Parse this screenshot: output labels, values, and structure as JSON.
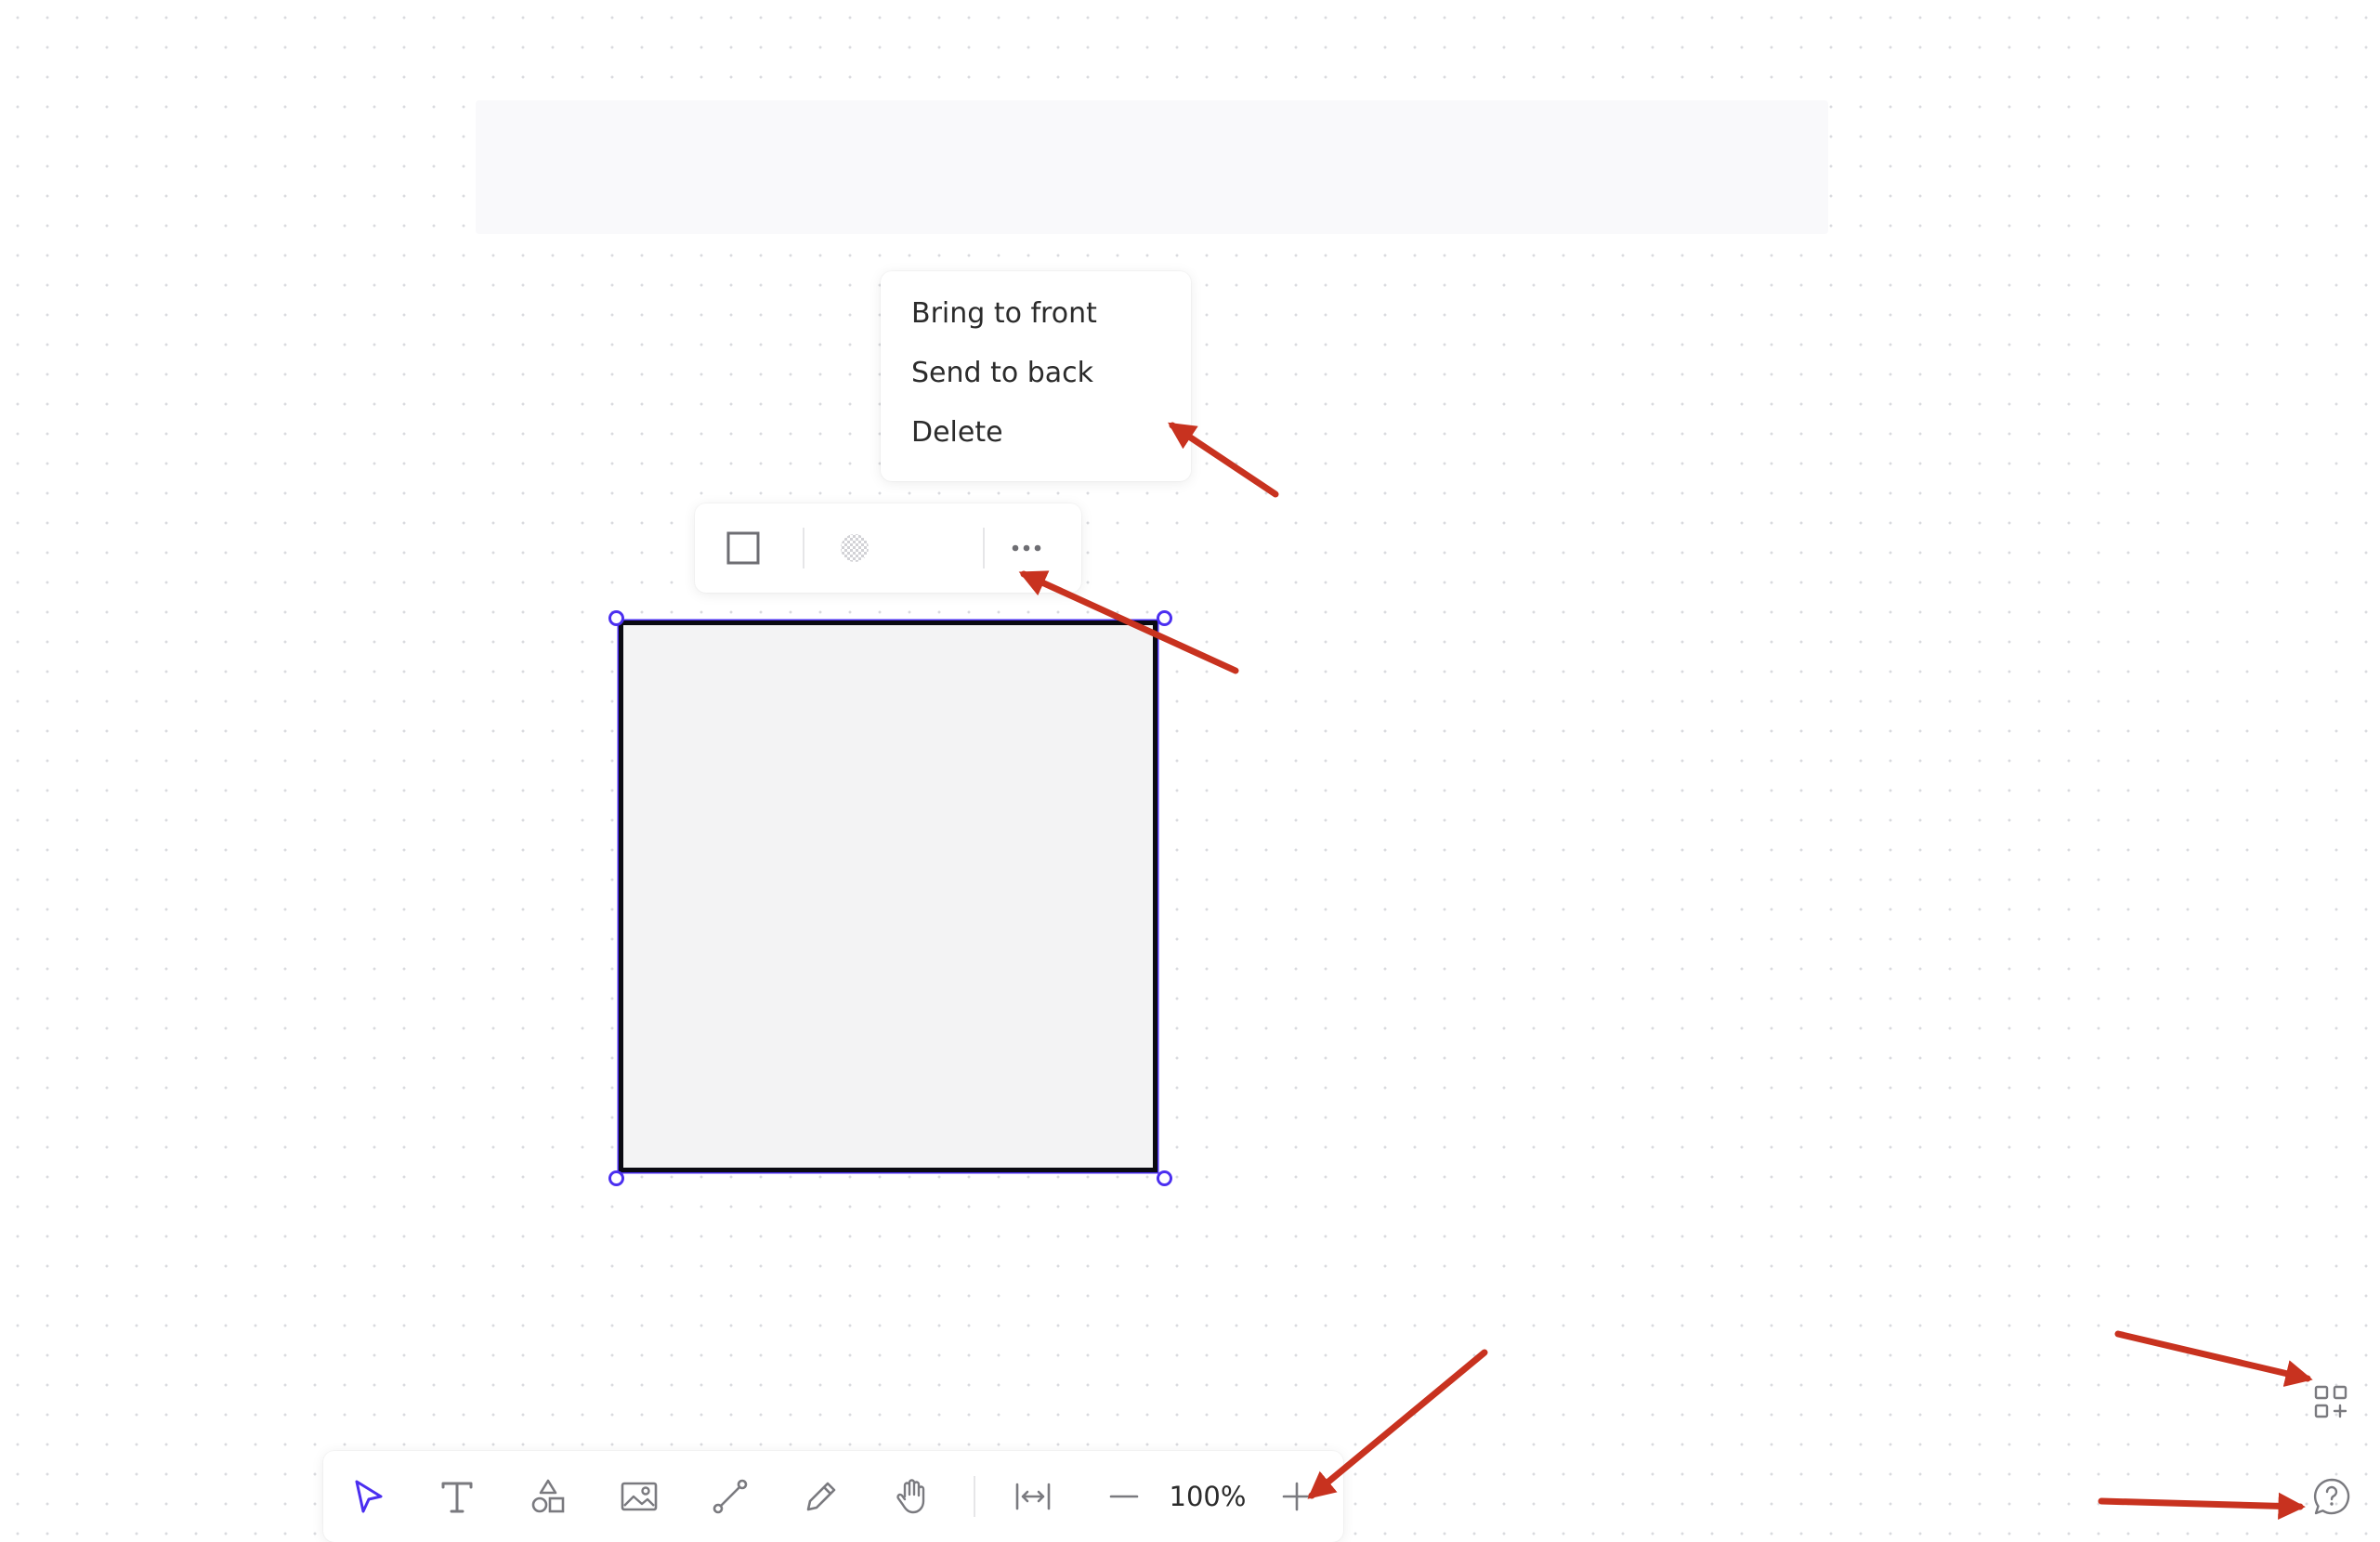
{
  "canvas": {
    "background": "#ffffff",
    "grid_dot_color": "#d9dade"
  },
  "context_menu": {
    "items": [
      {
        "label": "Bring to front"
      },
      {
        "label": "Send to back"
      },
      {
        "label": "Delete"
      }
    ]
  },
  "shape_toolbar": {
    "items": [
      {
        "icon": "square-outline-icon"
      },
      {
        "icon": "fill-pattern-icon"
      },
      {
        "icon": "more-horizontal-icon"
      }
    ]
  },
  "selected_shape": {
    "type": "rectangle",
    "fill": "#f3f3f4",
    "stroke": "#0a0a12",
    "selection_color": "#4b2ff0"
  },
  "bottom_toolbar": {
    "tools": [
      {
        "icon": "select-pointer-icon",
        "active": true
      },
      {
        "icon": "text-icon"
      },
      {
        "icon": "shapes-icon"
      },
      {
        "icon": "image-icon"
      },
      {
        "icon": "connector-icon"
      },
      {
        "icon": "pencil-icon"
      },
      {
        "icon": "hand-pan-icon"
      }
    ],
    "fit_width_icon": "fit-width-icon",
    "zoom_out_icon": "minus-icon",
    "zoom_level": "100%",
    "zoom_in_icon": "plus-icon"
  },
  "side_buttons": [
    {
      "icon": "add-widget-grid-icon"
    },
    {
      "icon": "help-chat-icon"
    }
  ],
  "annotations": {
    "arrow_color": "#c8321f"
  },
  "colors": {
    "accent": "#4b2ff0",
    "icon_gray": "#7a7a7f",
    "text": "#2b2b2b"
  }
}
